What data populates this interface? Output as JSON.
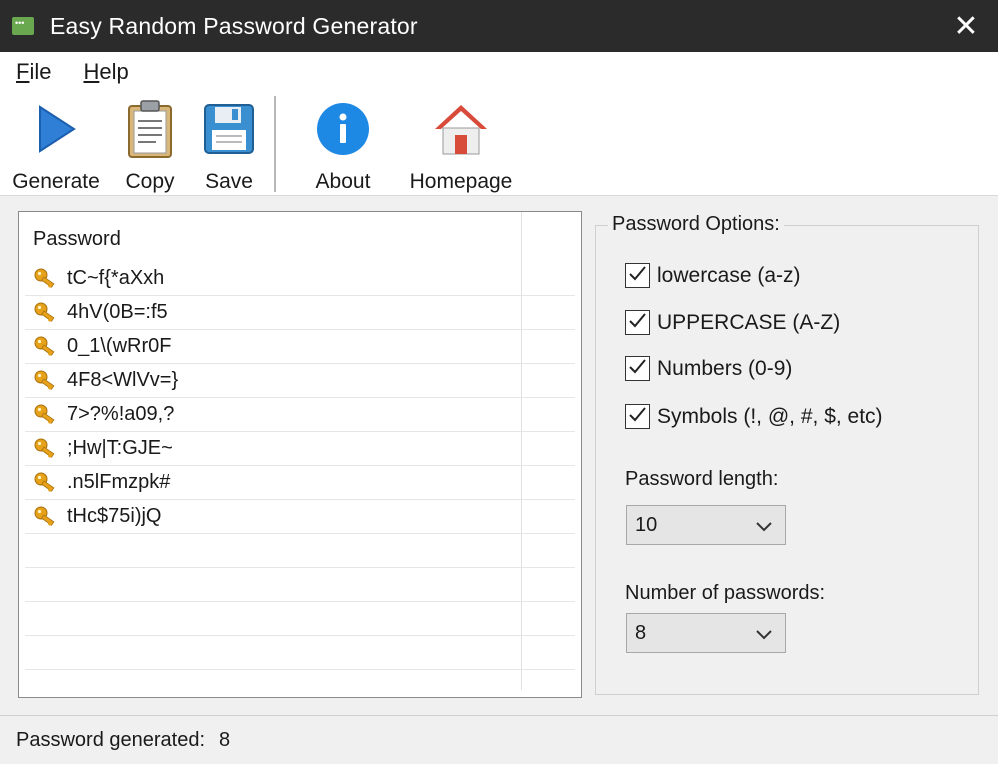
{
  "window": {
    "title": "Easy Random Password Generator",
    "close_glyph": "✕"
  },
  "menu": [
    {
      "accel": "F",
      "rest": "ile"
    },
    {
      "accel": "H",
      "rest": "elp"
    }
  ],
  "toolbar": {
    "generate": "Generate",
    "copy": "Copy",
    "save": "Save",
    "about": "About",
    "homepage": "Homepage"
  },
  "list": {
    "header": "Password",
    "passwords": [
      "tC~f{*aXxh",
      "4hV(0B=:f5",
      "0_1\\(wRr0F",
      "4F8<WlVv=}",
      "7>?%!a09,?",
      ";Hw|T:GJE~",
      ".n5lFmzpk#",
      "tHc$75i)jQ"
    ],
    "empty_rows": 5
  },
  "options": {
    "title": "Password Options:",
    "checkboxes": [
      {
        "label": "lowercase (a-z)",
        "checked": true
      },
      {
        "label": "UPPERCASE (A-Z)",
        "checked": true
      },
      {
        "label": "Numbers (0-9)",
        "checked": true
      },
      {
        "label": "Symbols (!, @, #, $, etc)",
        "checked": true
      }
    ],
    "length_label": "Password length:",
    "length_value": "10",
    "count_label": "Number of passwords:",
    "count_value": "8"
  },
  "status": {
    "label": "Password generated:",
    "value": "8"
  },
  "colors": {
    "titlebar": "#2b2b2b",
    "play_blue": "#2f7fd6",
    "info_blue": "#1e88e5",
    "key_gold": "#e6a21a",
    "house_red": "#d84a3a"
  }
}
